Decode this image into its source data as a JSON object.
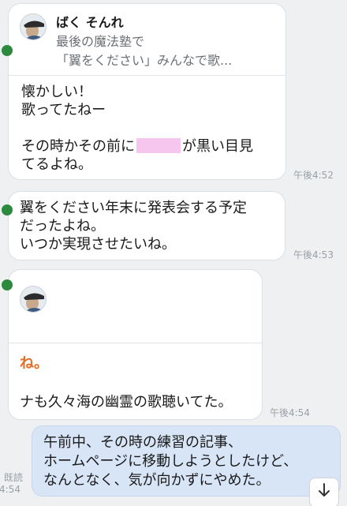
{
  "colors": {
    "background": "#eef0f2",
    "incoming_bubble": "#ffffff",
    "outgoing_bubble": "#d7e5f7",
    "redaction": "#f6c6ee",
    "timestamp": "#9aa0a6"
  },
  "messages": [
    {
      "shared_post": {
        "author": "ばく そんれ",
        "line1": "最後の魔法塾で",
        "line2": "「翼をください」みんなで歌..."
      },
      "text_lines": [
        "懐かしい！",
        "歌ってたねー",
        "",
        "その時かその前に",
        "が黒い目見",
        "てるよね。"
      ],
      "time": "午後4:52"
    },
    {
      "text_lines": [
        "翼をください年末に発表会する予定",
        "だったよね。",
        "いつか実現させたいね。"
      ],
      "time": "午後4:53"
    },
    {
      "sticker_text": "ね。",
      "text": "ナも久々海の幽霊の歌聴いてた。",
      "time": "午後4:54"
    },
    {
      "outgoing": true,
      "text_lines": [
        "午前中、その時の練習の記事、",
        "ホームページに移動しようとしたけど、",
        "なんとなく、気が向かずにやめた。"
      ],
      "read_label": "既読",
      "time_partial": "4:54"
    }
  ],
  "scroll_icon": "arrow-down-icon"
}
